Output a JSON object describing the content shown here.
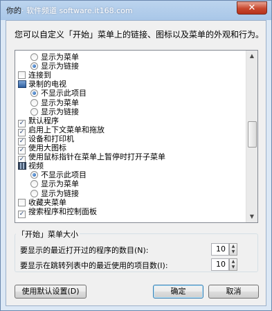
{
  "window": {
    "title": "你的",
    "watermark": "· 软件频道 software.it168.com",
    "close_glyph": "✕"
  },
  "description": "您可以自定义「开始」菜单上的链接、图标以及菜单的外观和行为。",
  "list_items": [
    {
      "type": "radio",
      "indent": 1,
      "checked": false,
      "label": "显示为菜单"
    },
    {
      "type": "radio",
      "indent": 1,
      "checked": true,
      "label": "显示为链接"
    },
    {
      "type": "checkbox",
      "indent": 0,
      "checked": false,
      "label": "连接到"
    },
    {
      "type": "header",
      "icon": "tv-icon",
      "label": "录制的电视"
    },
    {
      "type": "radio",
      "indent": 1,
      "checked": true,
      "label": "不显示此项目"
    },
    {
      "type": "radio",
      "indent": 1,
      "checked": false,
      "label": "显示为菜单"
    },
    {
      "type": "radio",
      "indent": 1,
      "checked": false,
      "label": "显示为链接"
    },
    {
      "type": "checkbox",
      "indent": 0,
      "checked": true,
      "label": "默认程序"
    },
    {
      "type": "checkbox",
      "indent": 0,
      "checked": true,
      "label": "启用上下文菜单和拖放"
    },
    {
      "type": "checkbox",
      "indent": 0,
      "checked": true,
      "label": "设备和打印机"
    },
    {
      "type": "checkbox",
      "indent": 0,
      "checked": true,
      "label": "使用大图标"
    },
    {
      "type": "checkbox",
      "indent": 0,
      "checked": true,
      "label": "使用鼠标指针在菜单上暂停时打开子菜单"
    },
    {
      "type": "header",
      "icon": "video-icon",
      "label": "视频"
    },
    {
      "type": "radio",
      "indent": 1,
      "checked": true,
      "label": "不显示此项目"
    },
    {
      "type": "radio",
      "indent": 1,
      "checked": false,
      "label": "显示为菜单"
    },
    {
      "type": "radio",
      "indent": 1,
      "checked": false,
      "label": "显示为链接"
    },
    {
      "type": "checkbox",
      "indent": 0,
      "checked": false,
      "label": "收藏夹菜单"
    },
    {
      "type": "checkbox",
      "indent": 0,
      "checked": true,
      "label": "搜索程序和控制面板"
    }
  ],
  "menu_size": {
    "title": "「开始」菜单大小",
    "recent_programs_label": "要显示的最近打开过的程序的数目(N):",
    "recent_programs_value": "10",
    "jumplist_label": "要显示在跳转列表中的最近使用的项目数(I):",
    "jumplist_value": "10"
  },
  "buttons": {
    "use_defaults": "使用默认设置(D)",
    "ok": "确定",
    "cancel": "取消"
  },
  "scroll": {
    "up": "▲",
    "down": "▼"
  },
  "spin": {
    "up": "▲",
    "down": "▼"
  },
  "check_glyph": "✓"
}
